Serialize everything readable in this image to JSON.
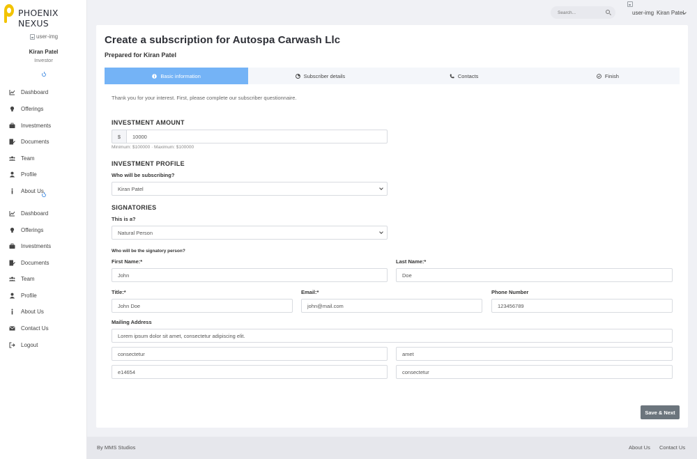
{
  "brand": {
    "name": "PHOENIX NEXUS",
    "accent": "#f2c300"
  },
  "sidebar": {
    "user_img_alt": "user-img",
    "user_name": "Kiran Patel",
    "user_role": "Investor",
    "menu1": [
      {
        "label": "Dashboard",
        "icon": "chart-line-icon"
      },
      {
        "label": "Offerings",
        "icon": "lightbulb-icon"
      },
      {
        "label": "Investments",
        "icon": "briefcase-icon"
      },
      {
        "label": "Documents",
        "icon": "file-signature-icon"
      },
      {
        "label": "Team",
        "icon": "users-icon"
      },
      {
        "label": "Profile",
        "icon": "user-icon"
      },
      {
        "label": "About Us",
        "icon": "info-icon"
      }
    ],
    "menu2": [
      {
        "label": "Dashboard",
        "icon": "chart-line-icon"
      },
      {
        "label": "Offerings",
        "icon": "lightbulb-icon"
      },
      {
        "label": "Investments",
        "icon": "briefcase-icon"
      },
      {
        "label": "Documents",
        "icon": "file-signature-icon"
      },
      {
        "label": "Team",
        "icon": "users-icon"
      },
      {
        "label": "Profile",
        "icon": "user-icon"
      },
      {
        "label": "About Us",
        "icon": "info-icon"
      },
      {
        "label": "Contact Us",
        "icon": "envelope-icon"
      },
      {
        "label": "Logout",
        "icon": "sign-out-icon"
      }
    ]
  },
  "topbar": {
    "search_placeholder": "Search...",
    "user_img_alt": "user-img",
    "user_name": "Kiran Patel"
  },
  "page": {
    "title": "Create a subscription for Autospa Carwash Llc",
    "prepared_for": "Prepared for Kiran Patel",
    "steps": [
      {
        "label": "Basic information",
        "icon": "info-circle-icon",
        "active": true
      },
      {
        "label": "Subscriber details",
        "icon": "pie-chart-icon",
        "active": false
      },
      {
        "label": "Contacts",
        "icon": "phone-icon",
        "active": false
      },
      {
        "label": "Finish",
        "icon": "check-circle-icon",
        "active": false
      }
    ],
    "intro": "Thank you for your interest. First, please complete our subscriber questionnaire."
  },
  "form": {
    "investment_amount": {
      "title": "INVESTMENT AMOUNT",
      "currency": "$",
      "value": "10000",
      "hint": "Minimum: $100000 · Maximum: $100000"
    },
    "investment_profile": {
      "title": "INVESTMENT PROFILE",
      "label": "Who will be subscribing?",
      "value": "Kiran Patel"
    },
    "signatories": {
      "title": "SIGNATORIES",
      "type_label": "This is a?",
      "type_value": "Natural Person",
      "person_label": "Who will be the signatory person?",
      "first_name_label": "First Name:*",
      "first_name": "John",
      "last_name_label": "Last Name:*",
      "last_name": "Doe",
      "title_label": "Title:*",
      "title_value": "John Doe",
      "email_label": "Email:*",
      "email": "john@mail.com",
      "phone_label": "Phone Number",
      "phone": "123456789",
      "address_label": "Mailing Address",
      "address_line": "Lorem ipsum dolor sit amet, consectetur adipiscing elit.",
      "address_city": "consectetur",
      "address_state": "amet",
      "address_zip": "e14654",
      "address_country": "consectetur"
    },
    "save_label": "Save & Next"
  },
  "footer": {
    "credit": "By MMS Studios",
    "about": "About Us",
    "contact": "Contact Us"
  }
}
